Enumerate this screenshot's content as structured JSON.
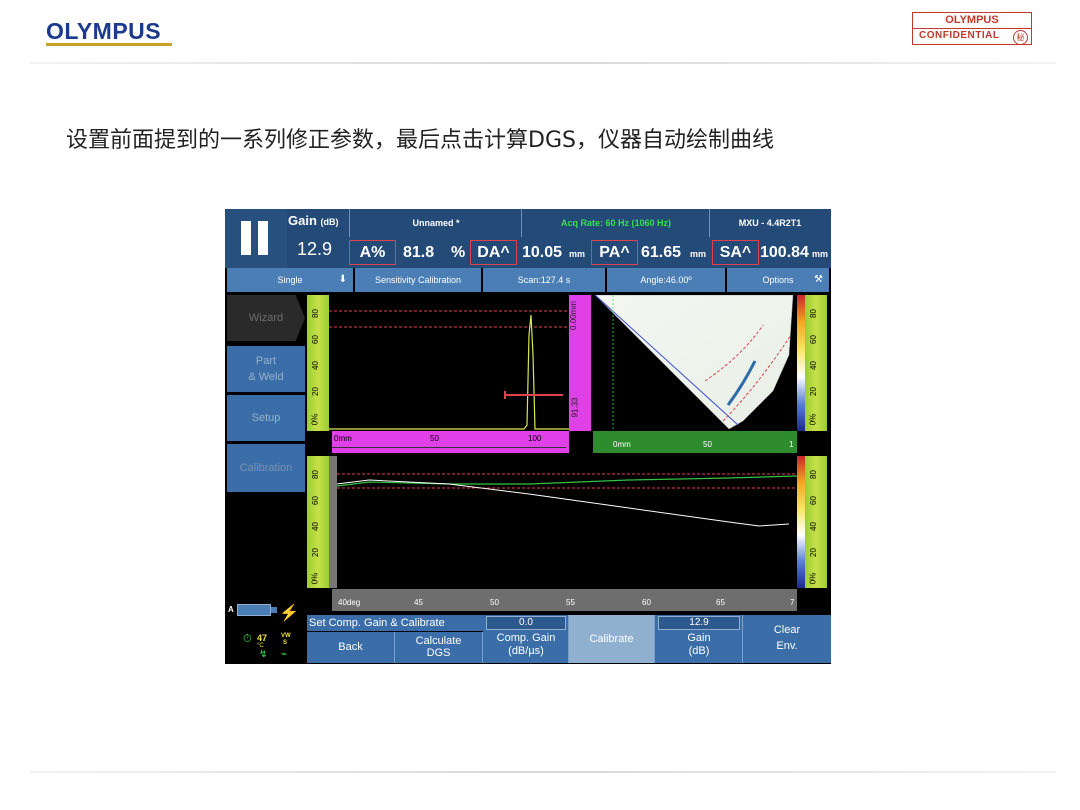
{
  "slide": {
    "logo": "OLYMPUS",
    "confidential_brand": "OLYMPUS",
    "confidential_label": "CONFIDENTIAL",
    "confidential_seal": "秘",
    "caption": "设置前面提到的一系列修正参数，最后点击计算DGS，仪器自动绘制曲线"
  },
  "device": {
    "header": {
      "gain_label": "Gain",
      "gain_unit": "(dB)",
      "gain_value": "12.9",
      "file_name": "Unnamed *",
      "acq_rate": "Acq Rate: 60 Hz (1060 Hz)",
      "model": "MXU - 4.4R2T1"
    },
    "readings": [
      {
        "label": "A%",
        "value": "81.8",
        "unit": "%"
      },
      {
        "label": "DA^",
        "value": "10.05",
        "unit": "mm"
      },
      {
        "label": "PA^",
        "value": "61.65",
        "unit": "mm"
      },
      {
        "label": "SA^",
        "value": "100.84",
        "unit": "mm"
      }
    ],
    "toolbar": {
      "mode": "Single",
      "calibration": "Sensitivity Calibration",
      "scan": "Scan:127.4 s",
      "angle": "Angle:46.00º",
      "options": "Options"
    },
    "sidebar": [
      {
        "label": "Wizard"
      },
      {
        "label": "Part\n& Weld"
      },
      {
        "label": "Setup"
      },
      {
        "label": "Calibration"
      }
    ],
    "ascan": {
      "left_scale_ticks": [
        "80",
        "60",
        "40",
        "20",
        "0%"
      ],
      "x_ticks": [
        "0mm",
        "50",
        "100"
      ],
      "gate_readout_top": "0.00mm",
      "gate_readout_bottom": "91.33"
    },
    "sscan": {
      "right_scale_ticks": [
        "80",
        "60",
        "40",
        "20",
        "0%"
      ],
      "x_ticks": [
        "0mm",
        "50",
        "1"
      ]
    },
    "cal_plot": {
      "left_scale_ticks": [
        "80",
        "60",
        "40",
        "20",
        "0%"
      ],
      "right_scale_ticks": [
        "80",
        "60",
        "40",
        "20",
        "0%"
      ],
      "x_ticks": [
        "40deg",
        "45",
        "50",
        "55",
        "60",
        "65",
        "7"
      ]
    },
    "status": {
      "probe_label": "A",
      "temperature": "47",
      "temp_unit": "°C",
      "power_label": "VW",
      "s_label": "S"
    },
    "bottom": {
      "title": "Set Comp. Gain & Calibrate",
      "buttons": [
        {
          "label": "Back"
        },
        {
          "label": "Calculate\nDGS"
        },
        {
          "label": "Comp. Gain\n(dB/µs)",
          "value": "0.0"
        },
        {
          "label": "Calibrate"
        },
        {
          "label": "Gain\n(dB)",
          "value": "12.9"
        },
        {
          "label": "Clear\nEnv."
        }
      ]
    }
  }
}
